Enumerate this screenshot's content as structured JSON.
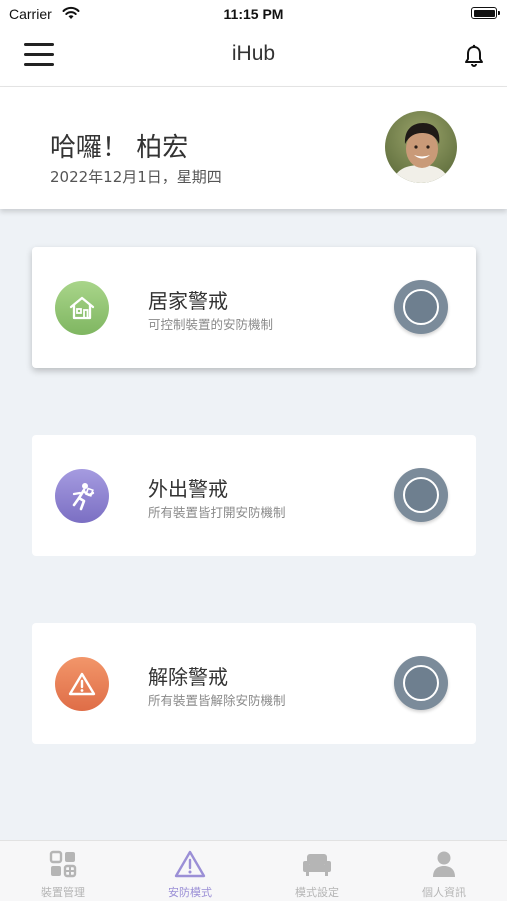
{
  "status_bar": {
    "carrier": "Carrier",
    "time": "11:15 PM"
  },
  "nav": {
    "title": "iHub"
  },
  "greeting": {
    "hello": "哈囉！ 柏宏",
    "date": "2022年12月1日，星期四"
  },
  "modes": [
    {
      "name": "居家警戒",
      "description": "可控制裝置的安防機制",
      "icon": "house-icon",
      "color": "#8bc06a",
      "active": true
    },
    {
      "name": "外出警戒",
      "description": "所有裝置皆打開安防機制",
      "icon": "running-person-icon",
      "color": "#8a7fd0",
      "active": false
    },
    {
      "name": "解除警戒",
      "description": "所有裝置皆解除安防機制",
      "icon": "warning-icon",
      "color": "#e97e57",
      "active": false
    }
  ],
  "tabs": [
    {
      "label": "裝置管理",
      "icon": "grid-icon",
      "selected": false
    },
    {
      "label": "安防模式",
      "icon": "warning-triangle-icon",
      "selected": true
    },
    {
      "label": "模式設定",
      "icon": "sofa-icon",
      "selected": false
    },
    {
      "label": "個人資訊",
      "icon": "person-icon",
      "selected": false
    }
  ],
  "colors": {
    "accent": "#9b8fd6",
    "toggle": "#7b8b9a",
    "background": "#eef2f6"
  }
}
